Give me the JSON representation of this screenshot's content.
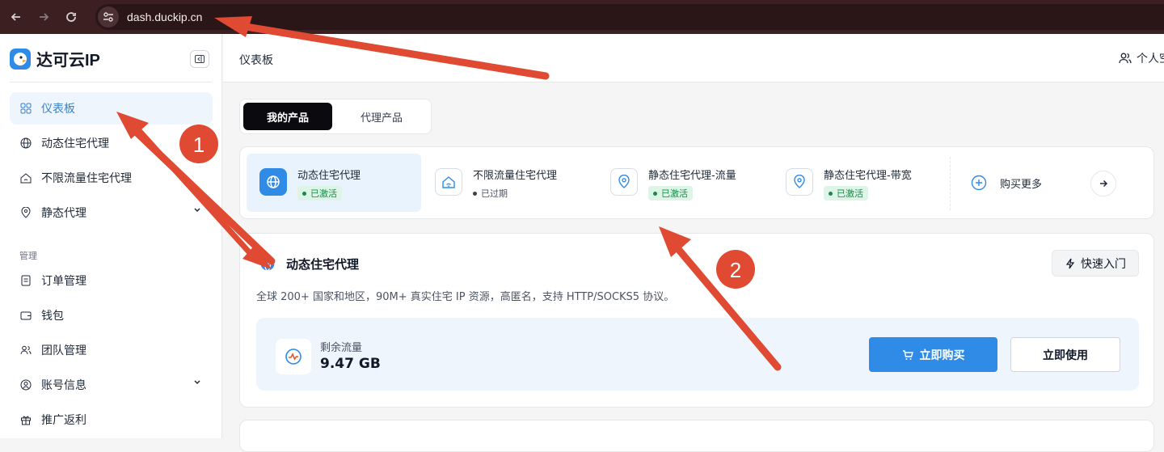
{
  "browser": {
    "url": "dash.duckip.cn"
  },
  "sidebar": {
    "brand": "达可云IP",
    "items": [
      {
        "label": "仪表板"
      },
      {
        "label": "动态住宅代理"
      },
      {
        "label": "不限流量住宅代理"
      },
      {
        "label": "静态代理"
      }
    ],
    "section_label": "管理",
    "manage_items": [
      {
        "label": "订单管理"
      },
      {
        "label": "钱包"
      },
      {
        "label": "团队管理"
      },
      {
        "label": "账号信息"
      },
      {
        "label": "推广返利"
      }
    ]
  },
  "header": {
    "breadcrumb": "仪表板",
    "profile_label": "个人空"
  },
  "tabs": {
    "active": "我的产品",
    "inactive": "代理产品"
  },
  "products": [
    {
      "name": "动态住宅代理",
      "status": "已激活"
    },
    {
      "name": "不限流量住宅代理",
      "status": "已过期"
    },
    {
      "name": "静态住宅代理-流量",
      "status": "已激活"
    },
    {
      "name": "静态住宅代理-带宽",
      "status": "已激活"
    }
  ],
  "buy_more": "购买更多",
  "detail": {
    "title": "动态住宅代理",
    "quick_entry": "快速入门",
    "description": "全球 200+ 国家和地区，90M+ 真实住宅 IP 资源，高匿名，支持 HTTP/SOCKS5 协议。",
    "remaining_label": "剩余流量",
    "remaining_value": "9.47 GB",
    "buy_now": "立即购买",
    "use_now": "立即使用"
  },
  "annotations": {
    "marker_1": "1",
    "marker_2": "2"
  },
  "colors": {
    "accent": "#2f8be6",
    "arrow": "#e04a32",
    "browser_bar": "#3b1f21"
  }
}
